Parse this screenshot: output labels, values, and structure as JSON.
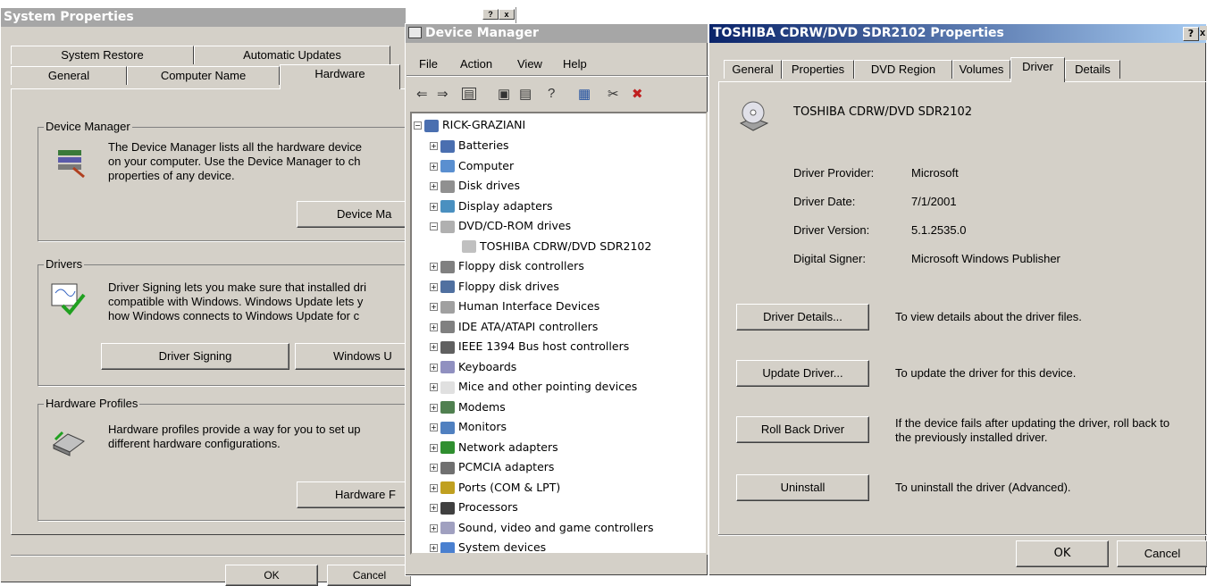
{
  "sys": {
    "title": "System Properties",
    "tabs_row1": [
      "System Restore",
      "Automatic Updates"
    ],
    "tabs_row2": [
      "General",
      "Computer Name",
      "Hardware"
    ],
    "dm_group": "Device Manager",
    "dm_text": [
      "The Device Manager lists all the hardware device",
      "on your computer. Use the Device Manager to ch",
      "properties of any device."
    ],
    "dm_btn": "Device Ma",
    "drv_group": "Drivers",
    "drv_text": [
      "Driver Signing lets you make sure that installed dri",
      "compatible with Windows. Windows Update lets y",
      "how Windows connects to Windows Update for c"
    ],
    "drv_btn1": "Driver Signing",
    "drv_btn2": "Windows U",
    "hw_group": "Hardware Profiles",
    "hw_text": [
      "Hardware profiles provide a way for you to set up",
      "different hardware configurations."
    ],
    "hw_btn": "Hardware F",
    "ok": "OK",
    "cancel": "Cancel"
  },
  "dm": {
    "title": "Device Manager",
    "menu": [
      "File",
      "Action",
      "View",
      "Help"
    ],
    "root": "RICK-GRAZIANI",
    "nodes": [
      {
        "label": "Batteries",
        "sign": "+",
        "color": "#4a6fb0",
        "indent": 1
      },
      {
        "label": "Computer",
        "sign": "+",
        "color": "#5a8fd0",
        "indent": 1
      },
      {
        "label": "Disk drives",
        "sign": "+",
        "color": "#909090",
        "indent": 1
      },
      {
        "label": "Display adapters",
        "sign": "+",
        "color": "#4a90c0",
        "indent": 1
      },
      {
        "label": "DVD/CD-ROM drives",
        "sign": "−",
        "color": "#b0b0b0",
        "indent": 1
      },
      {
        "label": "TOSHIBA CDRW/DVD SDR2102",
        "sign": "",
        "color": "#c0c0c0",
        "indent": 2
      },
      {
        "label": "Floppy disk controllers",
        "sign": "+",
        "color": "#808080",
        "indent": 1
      },
      {
        "label": "Floppy disk drives",
        "sign": "+",
        "color": "#5070a0",
        "indent": 1
      },
      {
        "label": "Human Interface Devices",
        "sign": "+",
        "color": "#a0a0a0",
        "indent": 1
      },
      {
        "label": "IDE ATA/ATAPI controllers",
        "sign": "+",
        "color": "#808080",
        "indent": 1
      },
      {
        "label": "IEEE 1394 Bus host controllers",
        "sign": "+",
        "color": "#606060",
        "indent": 1
      },
      {
        "label": "Keyboards",
        "sign": "+",
        "color": "#9090c0",
        "indent": 1
      },
      {
        "label": "Mice and other pointing devices",
        "sign": "+",
        "color": "#e0e0e0",
        "indent": 1
      },
      {
        "label": "Modems",
        "sign": "+",
        "color": "#508050",
        "indent": 1
      },
      {
        "label": "Monitors",
        "sign": "+",
        "color": "#5080c0",
        "indent": 1
      },
      {
        "label": "Network adapters",
        "sign": "+",
        "color": "#2f8f2f",
        "indent": 1
      },
      {
        "label": "PCMCIA adapters",
        "sign": "+",
        "color": "#707070",
        "indent": 1
      },
      {
        "label": "Ports (COM & LPT)",
        "sign": "+",
        "color": "#c0a020",
        "indent": 1
      },
      {
        "label": "Processors",
        "sign": "+",
        "color": "#404040",
        "indent": 1
      },
      {
        "label": "Sound, video and game controllers",
        "sign": "+",
        "color": "#a0a0c0",
        "indent": 1
      },
      {
        "label": "System devices",
        "sign": "+",
        "color": "#4a80d0",
        "indent": 1
      }
    ]
  },
  "props": {
    "title": "TOSHIBA CDRW/DVD SDR2102 Properties",
    "tabs": [
      "General",
      "Properties",
      "DVD Region",
      "Volumes",
      "Driver",
      "Details"
    ],
    "device_name": "TOSHIBA CDRW/DVD SDR2102",
    "fields": [
      {
        "label": "Driver Provider:",
        "value": "Microsoft"
      },
      {
        "label": "Driver Date:",
        "value": "7/1/2001"
      },
      {
        "label": "Driver Version:",
        "value": "5.1.2535.0"
      },
      {
        "label": "Digital Signer:",
        "value": "Microsoft Windows Publisher"
      }
    ],
    "actions": [
      {
        "button": "Driver Details...",
        "desc": "To view details about the driver files."
      },
      {
        "button": "Update Driver...",
        "desc": "To update the driver for this device."
      },
      {
        "button": "Roll Back Driver",
        "desc": "If the device fails after updating the driver, roll back to the previously installed driver."
      },
      {
        "button": "Uninstall",
        "desc": "To uninstall the driver (Advanced)."
      }
    ],
    "ok": "OK",
    "cancel": "Cancel"
  }
}
